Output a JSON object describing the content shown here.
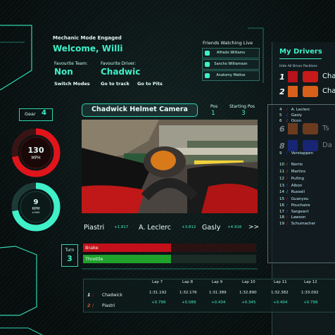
{
  "header": {
    "mode": "Mechanic Mode Engaged",
    "welcome": "Welcome, Willi",
    "team_label": "Favourite Team:",
    "team_value": "Non",
    "driver_label": "Favourite Driver:",
    "driver_value": "Chadwic",
    "links": [
      "Switch Modes",
      "Go to track",
      "Go to Pits"
    ]
  },
  "friends": {
    "title": "Friends Watching Live",
    "items": [
      "Alfredo Williams",
      "Sancho Williamson",
      "Anatomy Mattox"
    ]
  },
  "drivers": {
    "title": "My Drivers",
    "subtitle": "Hide All Driver Positions",
    "cards": [
      {
        "num": "1",
        "name": "Cha",
        "swatch": "#b5121b",
        "car": "#c91a1a"
      },
      {
        "num": "2",
        "name": "Cha",
        "swatch": "#d8601a",
        "car": "#d8601a"
      },
      {
        "num": "6",
        "name": "Ts",
        "swatch": "#d8601a",
        "car": "#d8601a"
      },
      {
        "num": "8",
        "name": "Da",
        "swatch": "#1c2fd8",
        "car": "#1c2fd8"
      }
    ]
  },
  "live_list": [
    {
      "pos": "4",
      "name": "A. Leclerc",
      "color": "#c91a1a"
    },
    {
      "pos": "5",
      "name": "Gasly",
      "color": "#1c6bd8"
    },
    {
      "pos": "6",
      "name": "Ocon",
      "color": "#d84aa0"
    },
    {
      "pos": "9",
      "name": "Verstappen",
      "color": "#1c2fd8"
    },
    {
      "pos": "10",
      "name": "Norris",
      "color": "#d8601a"
    },
    {
      "pos": "11",
      "name": "Martins",
      "color": "#d8601a"
    },
    {
      "pos": "12",
      "name": "Pulling",
      "color": "#c91a1a"
    },
    {
      "pos": "13",
      "name": "Albon",
      "color": "#1c6bd8"
    },
    {
      "pos": "14",
      "name": "Russell",
      "color": "#3ff0c8"
    },
    {
      "pos": "15",
      "name": "Guanyou",
      "color": "#c91a1a"
    },
    {
      "pos": "16",
      "name": "Pouchaire",
      "color": "#1c6bd8"
    },
    {
      "pos": "17",
      "name": "Sargeant",
      "color": "#1c6bd8"
    },
    {
      "pos": "18",
      "name": "Lawson",
      "color": "#c91a1a"
    },
    {
      "pos": "19",
      "name": "Schumacher",
      "color": "#c91a1a"
    }
  ],
  "gear": {
    "label": "Gear",
    "value": "4"
  },
  "speed": {
    "value": "130",
    "unit": "MPH",
    "fraction": 0.72
  },
  "rpm": {
    "value": "9",
    "unit": "RPM",
    "sub": "x1000",
    "fraction": 0.72
  },
  "camera": {
    "title": "Chadwick Helmet Camera",
    "pos_label": "Pos",
    "pos_value": "1",
    "start_label": "Starting Pos",
    "start_value": "3"
  },
  "gaps": [
    {
      "name": "Piastri",
      "gap": "+1.917"
    },
    {
      "name": "A. Leclerc",
      "gap": "+3.812"
    },
    {
      "name": "Gasly",
      "gap": "+4.916"
    }
  ],
  "gaps_next": ">>",
  "turn": {
    "label": "Turn",
    "value": "3"
  },
  "pedals": {
    "brake_label": "Brake",
    "brake": 0.51,
    "throttle_label": "Throttle",
    "throttle": 0.51
  },
  "laps": {
    "headers": [
      "Lap 7",
      "Lap 8",
      "Lap 9",
      "Lap 10",
      "Lap 11",
      "Lap 12"
    ],
    "rows": [
      {
        "num": "1",
        "name": "Chadwick",
        "times": [
          "1:31.192",
          "1:32.176",
          "1:31.389",
          "1:32.890",
          "1:32.382",
          "1:33.092"
        ]
      },
      {
        "num": "2",
        "name": "Piastri",
        "gaps": [
          "+0.799",
          "+0.589",
          "+0.434",
          "+0.345",
          "+0.404",
          "+0.799"
        ]
      }
    ]
  },
  "colors": {
    "accent": "#3ff0c8",
    "red": "#e0141b",
    "panel": "#121c1e"
  }
}
